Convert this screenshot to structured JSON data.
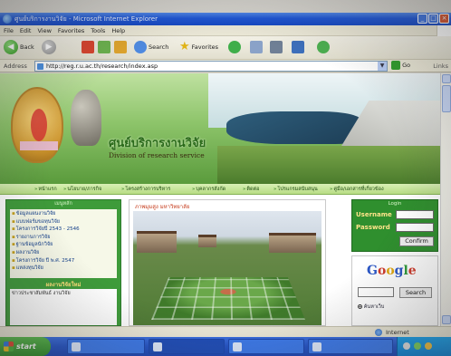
{
  "window": {
    "title": "ศูนย์บริการงานวิจัย - Microsoft Internet Explorer"
  },
  "menu": [
    "File",
    "Edit",
    "View",
    "Favorites",
    "Tools",
    "Help"
  ],
  "toolbar": {
    "back_label": "Back",
    "search_label": "Search",
    "favorites_label": "Favorites"
  },
  "address": {
    "label": "Address",
    "url": "http://reg.r.u.ac.th/research/index.asp",
    "go_label": "Go",
    "links_label": "Links"
  },
  "banner": {
    "dept_th": "ศูนย์บริการงานวิจัย",
    "dept_en": "Division of research service"
  },
  "nav": [
    "หน้าแรก",
    "นโยบาย/ภารกิจ",
    "โครงสร้างการบริหาร",
    "บุคลากรสังกัด",
    "ติดต่อ",
    "โปรแกรมสนับสนุน",
    "คู่มือ/เอกสารที่เกี่ยวข้อง"
  ],
  "left_panel": {
    "header": "เมนูหลัก",
    "links": [
      "ข้อมูลแผนงานวิจัย",
      "แบบฟอร์มขอทุนวิจัย",
      "โครงการวิจัยปี 2543 - 2546",
      "รายงานการวิจัย",
      "ฐานข้อมูลนักวิจัย",
      "ผลงานวิจัย",
      "โครงการวิจัย ปี พ.ศ. 2547",
      "แหล่งทุนวิจัย"
    ],
    "news_title": "ผลงานวิจัยใหม่",
    "news_items": [
      "ข่าวประชาสัมพันธ์ งานวิจัย"
    ]
  },
  "center": {
    "title": "ภาพมุมสูง มหาวิทยาลัย"
  },
  "login": {
    "header": "Login",
    "username_label": "Username",
    "password_label": "Password",
    "confirm_label": "Confirm"
  },
  "google": {
    "logo": "Google",
    "search_button": "Search",
    "radio_label": "ค้นหาเว็บ"
  },
  "status": {
    "zone": "Internet"
  },
  "taskbar": {
    "start_label": "start"
  }
}
